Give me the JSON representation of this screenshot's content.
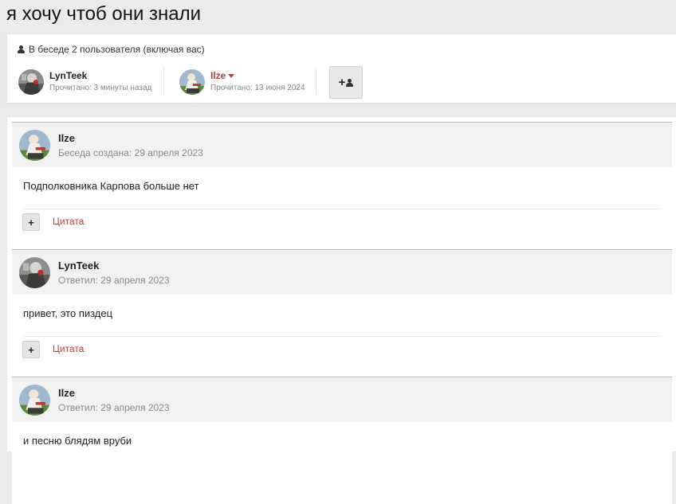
{
  "page": {
    "title": "я хочу чтоб они знали"
  },
  "participants": {
    "header": "В беседе 2 пользователя (включая вас)",
    "header_icon": "user-icon",
    "users": [
      {
        "name": "LynTeek",
        "read": "Прочитано: 3 минуты назад",
        "has_menu": false
      },
      {
        "name": "Ilze",
        "read": "Прочитано: 13 июня 2024",
        "has_menu": true,
        "name_color": "#b0413e"
      }
    ],
    "add_button_icon": "add-user-icon"
  },
  "messages": [
    {
      "author": "Ilze",
      "date": "Беседа создана: 29 апреля 2023",
      "text": "Подполковника Карпова больше нет",
      "quote_label": "Цитата",
      "plus_label": "+"
    },
    {
      "author": "LynTeek",
      "date": "Ответил: 29 апреля 2023",
      "text": "привет, это пиздец",
      "quote_label": "Цитата",
      "plus_label": "+"
    },
    {
      "author": "Ilze",
      "date": "Ответил: 29 апреля 2023",
      "text": "и песню блядям вруби"
    }
  ],
  "colors": {
    "accent": "#b0413e",
    "background": "#ebebeb",
    "header_bg": "#f2f2f2"
  }
}
